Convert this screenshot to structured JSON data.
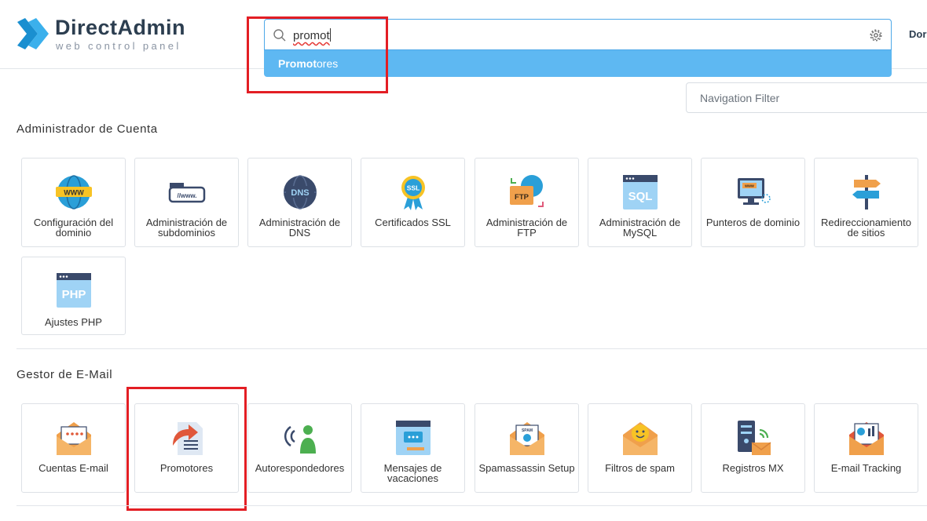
{
  "brand": {
    "title": "DirectAdmin",
    "subtitle": "web control panel"
  },
  "search": {
    "query": "promot",
    "suggestion_match": "Promot",
    "suggestion_rest": "ores"
  },
  "top_user": "Dor",
  "nav_filter": {
    "placeholder": "Navigation Filter"
  },
  "account": {
    "title": "Administrador de Cuenta",
    "tiles": [
      {
        "label": "Configuración del dominio",
        "icon": "www-globe-icon"
      },
      {
        "label": "Administración de subdominios",
        "icon": "subdomain-icon"
      },
      {
        "label": "Administración de DNS",
        "icon": "dns-globe-icon"
      },
      {
        "label": "Certificados SSL",
        "icon": "ssl-badge-icon"
      },
      {
        "label": "Administración de FTP",
        "icon": "ftp-folder-icon"
      },
      {
        "label": "Administración de MySQL",
        "icon": "sql-window-icon"
      },
      {
        "label": "Punteros de dominio",
        "icon": "monitor-pointer-icon"
      },
      {
        "label": "Redireccionamiento de sitios",
        "icon": "signpost-icon"
      },
      {
        "label": "Ajustes PHP",
        "icon": "php-window-icon"
      }
    ]
  },
  "email": {
    "title": "Gestor de E-Mail",
    "tiles": [
      {
        "label": "Cuentas E-mail",
        "icon": "email-envelope-icon"
      },
      {
        "label": "Promotores",
        "icon": "forwarder-icon"
      },
      {
        "label": "Autorespondedores",
        "icon": "autoresponder-icon"
      },
      {
        "label": "Mensajes de vacaciones",
        "icon": "vacation-message-icon"
      },
      {
        "label": "Spamassassin Setup",
        "icon": "spamassassin-icon"
      },
      {
        "label": "Filtros de spam",
        "icon": "spam-filter-icon"
      },
      {
        "label": "Registros MX",
        "icon": "mx-server-icon"
      },
      {
        "label": "E-mail Tracking",
        "icon": "email-tracking-icon"
      }
    ]
  },
  "colors": {
    "accent": "#5eb8f2",
    "highlight": "#e31e24",
    "brand_blue": "#2a9fd8"
  }
}
